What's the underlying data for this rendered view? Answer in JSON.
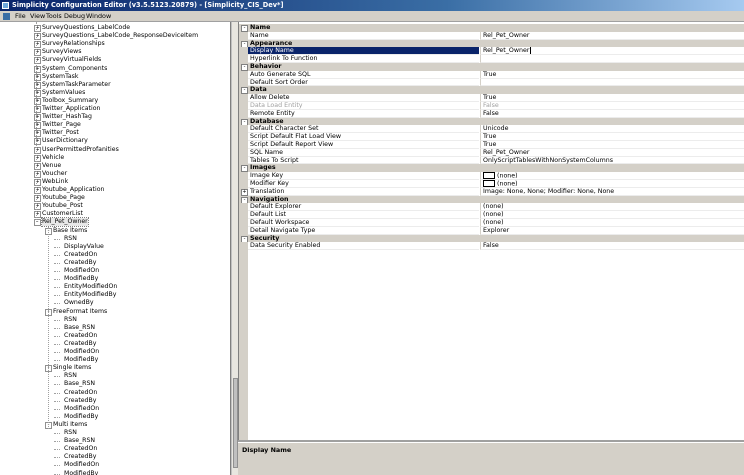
{
  "window": {
    "title": "Simplicity Configuration Editor (v3.5.5123.20879) - [Simplicity_CIS_Dev*]"
  },
  "menu": [
    "File",
    "View",
    "Tools",
    "Debug",
    "Window"
  ],
  "tree": {
    "rows": [
      {
        "label": "SurveyQuestions_LabelCode",
        "level": 0,
        "expander": "+"
      },
      {
        "label": "SurveyQuestions_LabelCode_ResponseDeviceItem",
        "level": 0,
        "expander": "+"
      },
      {
        "label": "SurveyRelationships",
        "level": 0,
        "expander": "+"
      },
      {
        "label": "SurveyViews",
        "level": 0,
        "expander": "+"
      },
      {
        "label": "SurveyVirtualFields",
        "level": 0,
        "expander": "+"
      },
      {
        "label": "System_Components",
        "level": 0,
        "expander": "+"
      },
      {
        "label": "SystemTask",
        "level": 0,
        "expander": "+"
      },
      {
        "label": "SystemTaskParameter",
        "level": 0,
        "expander": "+"
      },
      {
        "label": "SystemValues",
        "level": 0,
        "expander": "+"
      },
      {
        "label": "Toolbox_Summary",
        "level": 0,
        "expander": "+"
      },
      {
        "label": "Twitter_Application",
        "level": 0,
        "expander": "+"
      },
      {
        "label": "Twitter_HashTag",
        "level": 0,
        "expander": "+"
      },
      {
        "label": "Twitter_Page",
        "level": 0,
        "expander": "+"
      },
      {
        "label": "Twitter_Post",
        "level": 0,
        "expander": "+"
      },
      {
        "label": "UserDictionary",
        "level": 0,
        "expander": "+"
      },
      {
        "label": "UserPermittedProfanities",
        "level": 0,
        "expander": "+"
      },
      {
        "label": "Vehicle",
        "level": 0,
        "expander": "+"
      },
      {
        "label": "Venue",
        "level": 0,
        "expander": "+"
      },
      {
        "label": "Voucher",
        "level": 0,
        "expander": "+"
      },
      {
        "label": "WebLink",
        "level": 0,
        "expander": "+"
      },
      {
        "label": "Youtube_Application",
        "level": 0,
        "expander": "+"
      },
      {
        "label": "Youtube_Page",
        "level": 0,
        "expander": "+"
      },
      {
        "label": "Youtube_Post",
        "level": 0,
        "expander": "+"
      },
      {
        "label": "CustomerList",
        "level": 0,
        "expander": "+"
      },
      {
        "label": "Rel_Pet_Owner",
        "level": 0,
        "expander": "-",
        "selected": true
      },
      {
        "label": "Base Items",
        "level": 1,
        "expander": "-"
      },
      {
        "label": "RSN",
        "level": 2
      },
      {
        "label": "DisplayValue",
        "level": 2
      },
      {
        "label": "CreatedOn",
        "level": 2
      },
      {
        "label": "CreatedBy",
        "level": 2
      },
      {
        "label": "ModifiedOn",
        "level": 2
      },
      {
        "label": "ModifiedBy",
        "level": 2
      },
      {
        "label": "EntityModifiedOn",
        "level": 2
      },
      {
        "label": "EntityModifiedBy",
        "level": 2
      },
      {
        "label": "OwnedBy",
        "level": 2
      },
      {
        "label": "FreeFormat Items",
        "level": 1,
        "expander": "-"
      },
      {
        "label": "RSN",
        "level": 2
      },
      {
        "label": "Base_RSN",
        "level": 2
      },
      {
        "label": "CreatedOn",
        "level": 2
      },
      {
        "label": "CreatedBy",
        "level": 2
      },
      {
        "label": "ModifiedOn",
        "level": 2
      },
      {
        "label": "ModifiedBy",
        "level": 2
      },
      {
        "label": "Single Items",
        "level": 1,
        "expander": "-"
      },
      {
        "label": "RSN",
        "level": 2
      },
      {
        "label": "Base_RSN",
        "level": 2
      },
      {
        "label": "CreatedOn",
        "level": 2
      },
      {
        "label": "CreatedBy",
        "level": 2
      },
      {
        "label": "ModifiedOn",
        "level": 2
      },
      {
        "label": "ModifiedBy",
        "level": 2
      },
      {
        "label": "Multi Items",
        "level": 1,
        "expander": "-"
      },
      {
        "label": "RSN",
        "level": 2
      },
      {
        "label": "Base_RSN",
        "level": 2
      },
      {
        "label": "CreatedOn",
        "level": 2
      },
      {
        "label": "CreatedBy",
        "level": 2
      },
      {
        "label": "ModifiedOn",
        "level": 2
      },
      {
        "label": "ModifiedBy",
        "level": 2
      }
    ]
  },
  "properties": {
    "rows": [
      {
        "type": "cat",
        "label": "Name"
      },
      {
        "name": "Name",
        "value": "Rel_Pet_Owner"
      },
      {
        "type": "cat",
        "label": "Appearance"
      },
      {
        "name": "Display Name",
        "value": "Rel_Pet_Owner",
        "selected": true
      },
      {
        "name": "Hyperlink To Function",
        "value": ""
      },
      {
        "type": "cat",
        "label": "Behavior"
      },
      {
        "name": "Auto Generate SQL",
        "value": "True"
      },
      {
        "name": "Default Sort Order",
        "value": ""
      },
      {
        "type": "cat",
        "label": "Data"
      },
      {
        "name": "Allow Delete",
        "value": "True"
      },
      {
        "name": "Data Load Entity",
        "value": "False",
        "disabled": true
      },
      {
        "name": "Remote Entity",
        "value": "False"
      },
      {
        "type": "cat",
        "label": "Database"
      },
      {
        "name": "Default Character Set",
        "value": "Unicode"
      },
      {
        "name": "Script Default Flat Load View",
        "value": "True"
      },
      {
        "name": "Script Default Report View",
        "value": "True"
      },
      {
        "name": "SQL Name",
        "value": "Rel_Pet_Owner"
      },
      {
        "name": "Tables To Script",
        "value": "OnlyScriptTablesWithNonSystemColumns"
      },
      {
        "type": "cat",
        "label": "Images"
      },
      {
        "name": "Image Key",
        "value": "(none)",
        "swatch": true
      },
      {
        "name": "Modifier Key",
        "value": "(none)",
        "swatch": true
      },
      {
        "name": "Translation",
        "value": "Image: None, None; Modifier: None, None",
        "expander": true
      },
      {
        "type": "cat",
        "label": "Navigation"
      },
      {
        "name": "Default Explorer",
        "value": "(none)"
      },
      {
        "name": "Default List",
        "value": "(none)"
      },
      {
        "name": "Default Workspace",
        "value": "(none)"
      },
      {
        "name": "Detail Navigate Type",
        "value": "Explorer"
      },
      {
        "type": "cat",
        "label": "Security"
      },
      {
        "name": "Data Security Enabled",
        "value": "False"
      }
    ]
  },
  "help": {
    "title": "Display Name"
  }
}
